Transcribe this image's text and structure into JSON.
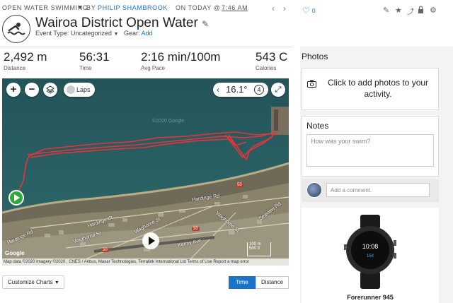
{
  "header": {
    "activity_type": "OPEN WATER SWIMMING",
    "by": "BY",
    "author": "PHILIP SHAMBROOK",
    "on": "ON TODAY @",
    "time": "7:46 AM",
    "title": "Wairoa District Open Water",
    "event_type_label": "Event Type:",
    "event_type_value": "Uncategorized",
    "gear_label": "Gear:",
    "gear_link": "Add"
  },
  "stats": [
    {
      "value": "2,492 m",
      "label": "Distance"
    },
    {
      "value": "56:31",
      "label": "Time"
    },
    {
      "value": "2:16 min/100m",
      "label": "Avg Pace"
    },
    {
      "value": "543 C",
      "label": "Calories"
    }
  ],
  "map": {
    "laps_label": "Laps",
    "temperature": "16.1°",
    "temp_badge": "4",
    "watermark": "©2020 Google",
    "copyright": "Map data ©2020 Imagery ©2020 , CNES / Airbus, Maxar Technologies, Terralink International Ltd   Terms of Use   Report a map error",
    "scale_label": "500 ft",
    "scale_label_metric": "100 m",
    "logo": "Google",
    "road_number": "50",
    "streets": [
      "Hardinge Rd",
      "Hardinge Rd",
      "Hardinge St",
      "Waghorne St",
      "Waghorne St",
      "Waghorne St",
      "Kenny Ave",
      "Seaview Rd"
    ]
  },
  "controls": {
    "customize_charts": "Customize Charts",
    "time_toggle": "Time",
    "distance_toggle": "Distance"
  },
  "sidebar": {
    "likes_count": "0",
    "photos_title": "Photos",
    "photos_prompt": "Click to add photos to your activity.",
    "notes_title": "Notes",
    "notes_placeholder": "How was your swim?",
    "comment_placeholder": "Add a comment.",
    "device_name": "Forerunner 945"
  },
  "colors": {
    "accent": "#1a73c9",
    "route": "#e8333b",
    "start_marker": "#2eaa3b"
  }
}
